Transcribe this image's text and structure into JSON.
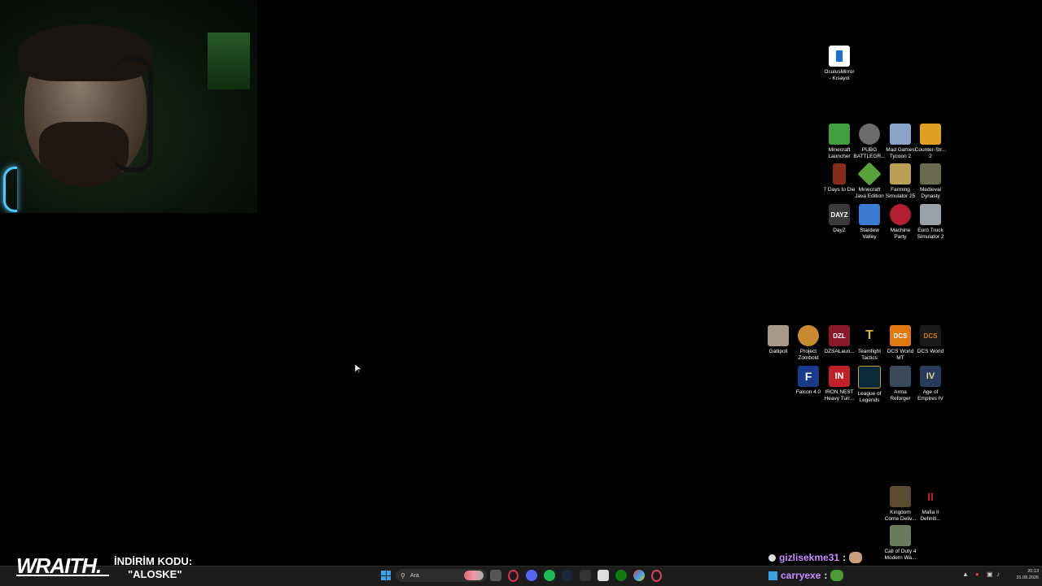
{
  "overlay": {
    "brand": "WRAITH.",
    "promo_line1": "İNDİRİM KODU:",
    "promo_line2": "\"ALOSKE\""
  },
  "chat": {
    "line1_user": "gizlisekme31",
    "line1_sep": ":",
    "line2_user": "carryexe",
    "line2_sep": ":"
  },
  "desktop_icons": {
    "oculus": "OculusMirror - Kısayol",
    "minecraft_launcher": "Minecraft Launcher",
    "pubg": "PUBG BATTLEGR...",
    "mad_games": "Mad Games Tycoon 2",
    "counter_strike": "Counter-Str... 2",
    "seven_days": "7 Days to Die",
    "minecraft_java": "Minecraft Java Edition",
    "farming": "Farming Simulator 25",
    "medieval": "Medieval Dynasty",
    "dayz": "DayZ",
    "stardew": "Stardew Valley",
    "machine_party": "Machine Party",
    "euro_truck": "Euro Truck Simulator 2",
    "gallipoli": "Gallipoli",
    "zomboid": "Project Zomboid",
    "dzsa": "DZSALaun...",
    "teamfight": "Teamfight Tactics",
    "dcs_mt": "DCS World MT",
    "dcs": "DCS World",
    "falcon": "Falcon 4.0",
    "iron_nest": "IRON NEST Heavy Turr...",
    "lol": "League of Legends",
    "arma": "Arma Reforger",
    "aoe": "Age of Empires IV",
    "kingdom": "Kingdom Come Deliv...",
    "mafia": "Mafia II Definiti...",
    "cod": "Call of Duty 4 Modern Wa..."
  },
  "icon_glyphs": {
    "dayz": "DAYZ",
    "dzsa": "DZL",
    "dcs": "DCS",
    "falcon": "F",
    "iron_nest": "IN",
    "aoe": "IV"
  },
  "taskbar": {
    "search_placeholder": "Ara",
    "time": "20:13",
    "date": "31.08.2026"
  },
  "colors": {
    "accent_purple": "#c78bff",
    "taskbar_bg": "#1c1c1c",
    "webcam_glow": "#4fc7ff"
  }
}
